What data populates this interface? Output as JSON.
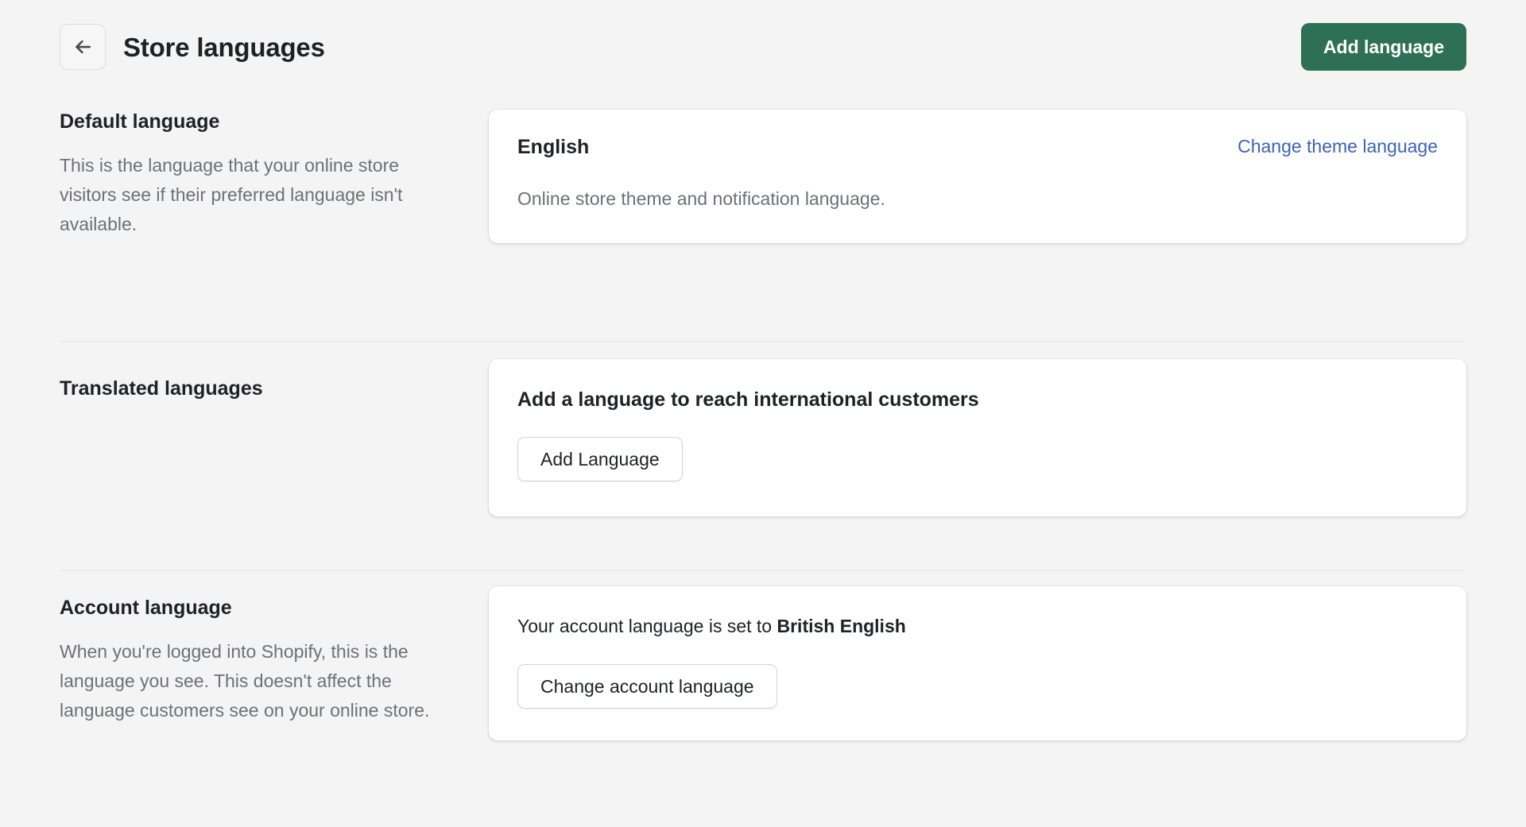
{
  "header": {
    "back_icon": "arrow-left-icon",
    "title": "Store languages",
    "primary_action": "Add language",
    "primary_color": "#2e7057"
  },
  "link_color": "#3b63ba",
  "sections": {
    "default_language": {
      "heading": "Default language",
      "description": "This is the language that your online store visitors see if their preferred language isn't available.",
      "card": {
        "language": "English",
        "change_link": "Change theme language",
        "subtext": "Online store theme and notification language."
      }
    },
    "translated_languages": {
      "heading": "Translated languages",
      "card": {
        "heading": "Add a language to reach international customers",
        "button": "Add Language"
      }
    },
    "account_language": {
      "heading": "Account language",
      "description": "When you're logged into Shopify, this is the language you see. This doesn't affect the language customers see on your online store.",
      "card": {
        "text_prefix": "Your account language is set to ",
        "text_value": "British English",
        "button": "Change account language"
      }
    }
  }
}
